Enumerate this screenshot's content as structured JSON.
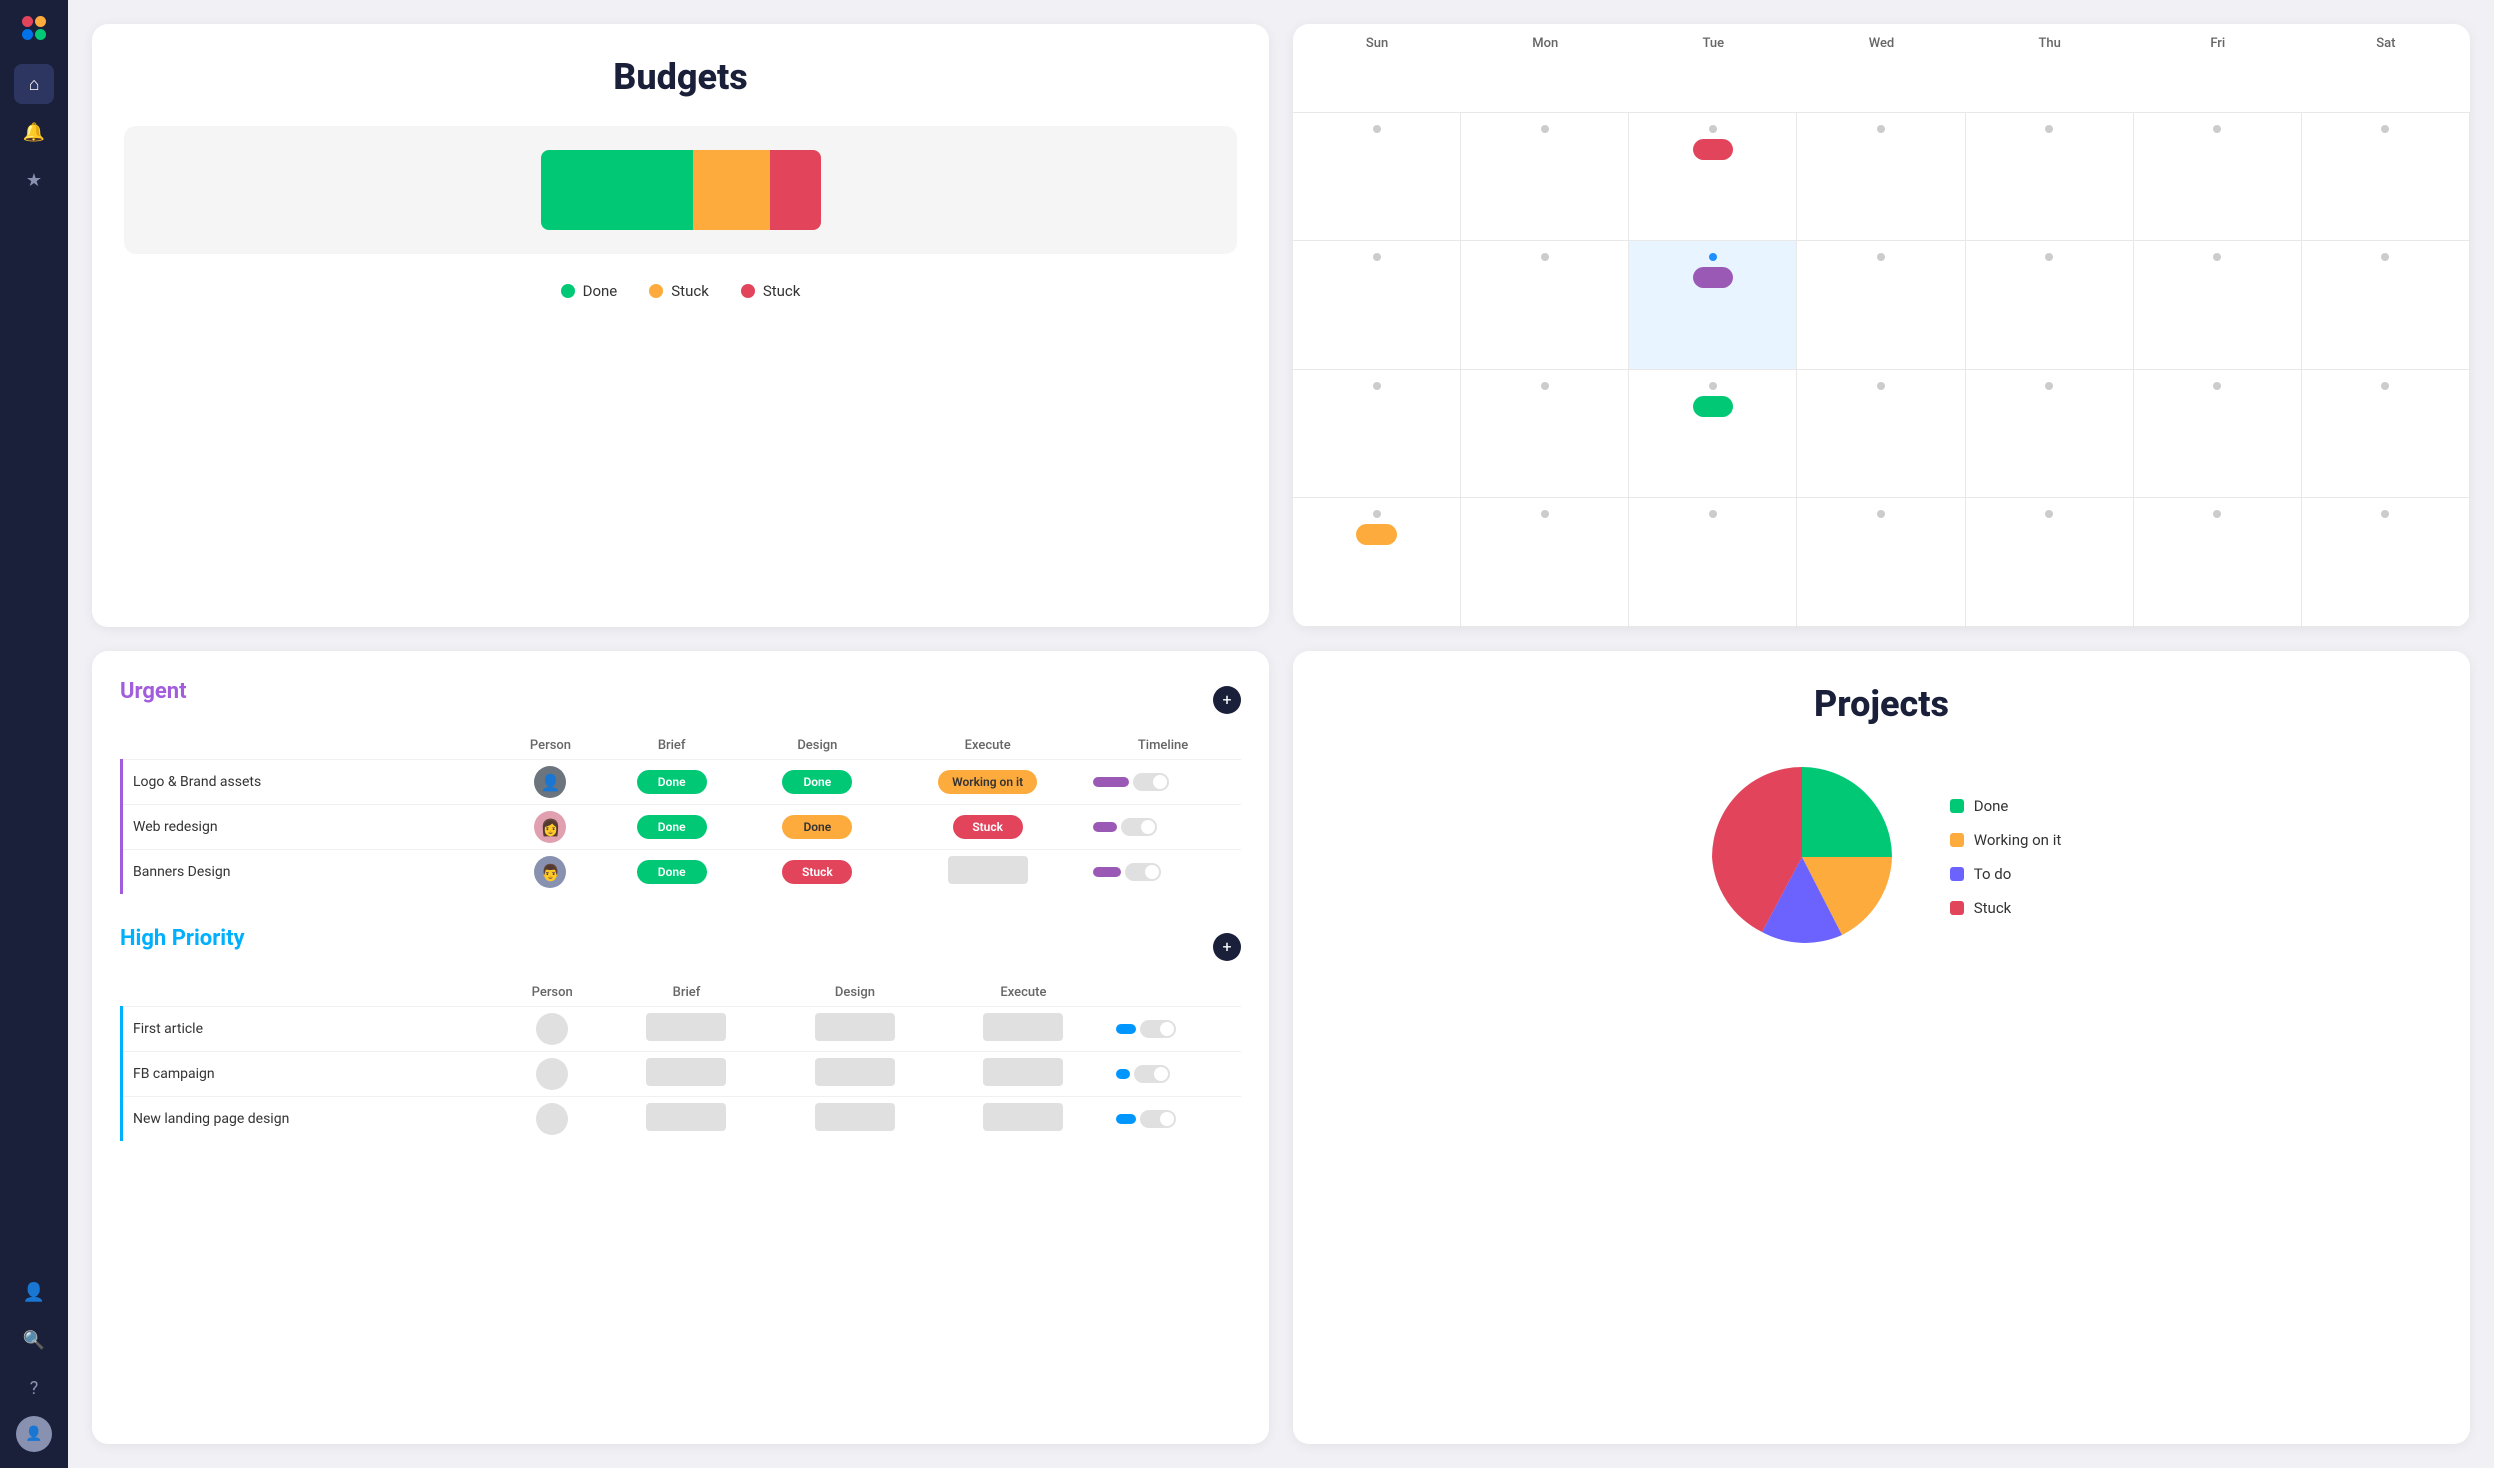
{
  "sidebar": {
    "icons": [
      {
        "name": "home-icon",
        "symbol": "⌂",
        "active": true
      },
      {
        "name": "bell-icon",
        "symbol": "🔔",
        "active": false
      },
      {
        "name": "star-icon",
        "symbol": "★",
        "active": false
      },
      {
        "name": "user-add-icon",
        "symbol": "👤+",
        "active": false
      },
      {
        "name": "search-icon",
        "symbol": "🔍",
        "active": false
      },
      {
        "name": "help-icon",
        "symbol": "?",
        "active": false
      }
    ]
  },
  "budgets": {
    "title": "Budgets",
    "legend": [
      {
        "label": "Done",
        "color": "#00c875"
      },
      {
        "label": "Stuck",
        "color": "#fdab3d"
      },
      {
        "label": "Stuck",
        "color": "#e2445c"
      }
    ]
  },
  "calendar": {
    "days": [
      "Sun",
      "Mon",
      "Tue",
      "Wed",
      "Thu",
      "Fri",
      "Sat"
    ]
  },
  "urgent": {
    "title": "Urgent",
    "columns": [
      "Person",
      "Brief",
      "Design",
      "Execute",
      "Timeline"
    ],
    "rows": [
      {
        "name": "Logo & Brand assets",
        "brief": "Done",
        "design": "Done",
        "execute": "Working on it",
        "timeline_color": "#9b59b6",
        "person": "👤"
      },
      {
        "name": "Web redesign",
        "brief": "Done",
        "design": "Done",
        "execute": "Stuck",
        "timeline_color": "#9b59b6",
        "person": "👩"
      },
      {
        "name": "Banners Design",
        "brief": "Done",
        "design": "Stuck",
        "execute": "",
        "timeline_color": "#9b59b6",
        "person": "👨"
      }
    ]
  },
  "high_priority": {
    "title": "High Priority",
    "columns": [
      "Person",
      "Brief",
      "Design",
      "Execute"
    ],
    "rows": [
      {
        "name": "First article",
        "timeline_color": "#0096ff"
      },
      {
        "name": "FB campaign",
        "timeline_color": "#0096ff"
      },
      {
        "name": "New landing page design",
        "timeline_color": "#0096ff"
      }
    ]
  },
  "projects": {
    "title": "Projects",
    "legend": [
      {
        "label": "Done",
        "color": "#00c875"
      },
      {
        "label": "Working on it",
        "color": "#fdab3d"
      },
      {
        "label": "To do",
        "color": "#6c63ff"
      },
      {
        "label": "Stuck",
        "color": "#e2445c"
      }
    ]
  }
}
